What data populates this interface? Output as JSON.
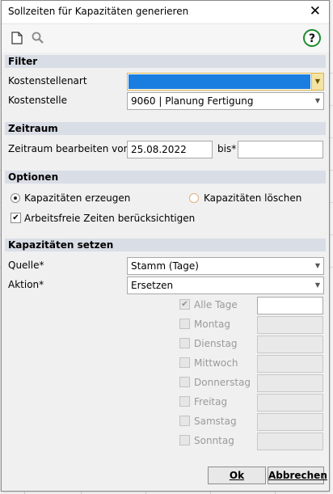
{
  "window": {
    "title": "Sollzeiten für Kapazitäten generieren"
  },
  "icons": {
    "close": "close-icon",
    "new": "new-document-icon",
    "search": "search-icon",
    "help": "help-icon"
  },
  "help_glyph": "?",
  "sections": {
    "filter": {
      "title": "Filter",
      "kostenstellenart_label": "Kostenstellenart",
      "kostenstellenart_value": "",
      "kostenstelle_label": "Kostenstelle",
      "kostenstelle_value": "9060 | Planung Fertigung"
    },
    "zeitraum": {
      "title": "Zeitraum",
      "von_label": "Zeitraum bearbeiten von*",
      "von_value": "25.08.2022",
      "bis_label": "bis*",
      "bis_value": ""
    },
    "optionen": {
      "title": "Optionen",
      "erzeugen_label": "Kapazitäten erzeugen",
      "erzeugen_selected": true,
      "loeschen_label": "Kapazitäten löschen",
      "loeschen_selected": false,
      "arbeitsfrei_label": "Arbeitsfreie Zeiten berücksichtigen",
      "arbeitsfrei_checked": true
    },
    "kapazitaeten": {
      "title": "Kapazitäten setzen",
      "quelle_label": "Quelle*",
      "quelle_value": "Stamm (Tage)",
      "aktion_label": "Aktion*",
      "aktion_value": "Ersetzen",
      "days": [
        {
          "label": "Alle Tage",
          "checked": true,
          "value": ""
        },
        {
          "label": "Montag",
          "checked": false,
          "value": ""
        },
        {
          "label": "Dienstag",
          "checked": false,
          "value": ""
        },
        {
          "label": "Mittwoch",
          "checked": false,
          "value": ""
        },
        {
          "label": "Donnerstag",
          "checked": false,
          "value": ""
        },
        {
          "label": "Freitag",
          "checked": false,
          "value": ""
        },
        {
          "label": "Samstag",
          "checked": false,
          "value": ""
        },
        {
          "label": "Sonntag",
          "checked": false,
          "value": ""
        }
      ]
    }
  },
  "footer": {
    "ok_label": "Ok",
    "cancel_label": "Abbrechen"
  },
  "colors": {
    "section_header": "#d9dde6",
    "selection": "#1a7de0",
    "help_ring": "#1e8a2e"
  }
}
